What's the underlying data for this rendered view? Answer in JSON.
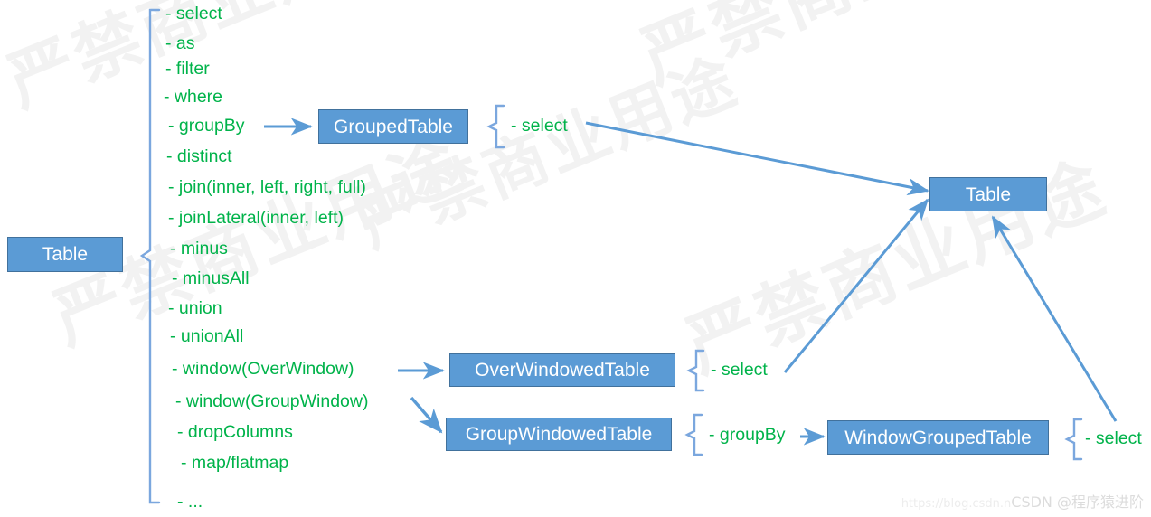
{
  "diagram": {
    "title": "Flink Table API operation flow",
    "colors": {
      "box_fill": "#5B9BD5",
      "box_border": "#41719C",
      "box_text": "#FFFFFF",
      "method_text": "#00B34A",
      "connector": "#5B9BD5",
      "watermark": "#F2F2F2"
    },
    "boxes": [
      {
        "id": "table_left",
        "label": "Table"
      },
      {
        "id": "grouped_table",
        "label": "GroupedTable"
      },
      {
        "id": "table_right",
        "label": "Table"
      },
      {
        "id": "over_windowed_table",
        "label": "OverWindowedTable"
      },
      {
        "id": "group_windowed_table",
        "label": "GroupWindowedTable"
      },
      {
        "id": "window_grouped_table",
        "label": "WindowGroupedTable"
      }
    ],
    "table_methods": [
      "- select",
      "- as",
      "- filter",
      "- where",
      "- groupBy",
      "- distinct",
      "- join(inner, left, right, full)",
      "- joinLateral(inner, left)",
      "- minus",
      "- minusAll",
      "- union",
      "- unionAll",
      "- window(OverWindow)",
      "- window(GroupWindow)",
      "- dropColumns",
      "- map/flatmap",
      "- ..."
    ],
    "grouped_table_methods": [
      "- select"
    ],
    "over_windowed_table_methods": [
      "- select"
    ],
    "group_windowed_table_methods": [
      "- groupBy"
    ],
    "window_grouped_table_methods": [
      "- select"
    ],
    "watermarks": [
      "严禁商业用途",
      "严禁商业用途",
      "严禁商业用途",
      "严禁商业用途",
      "严禁商业用途"
    ]
  },
  "footer": {
    "url": "https://blog.csdn.n",
    "credit": "CSDN @程序猿进阶"
  }
}
